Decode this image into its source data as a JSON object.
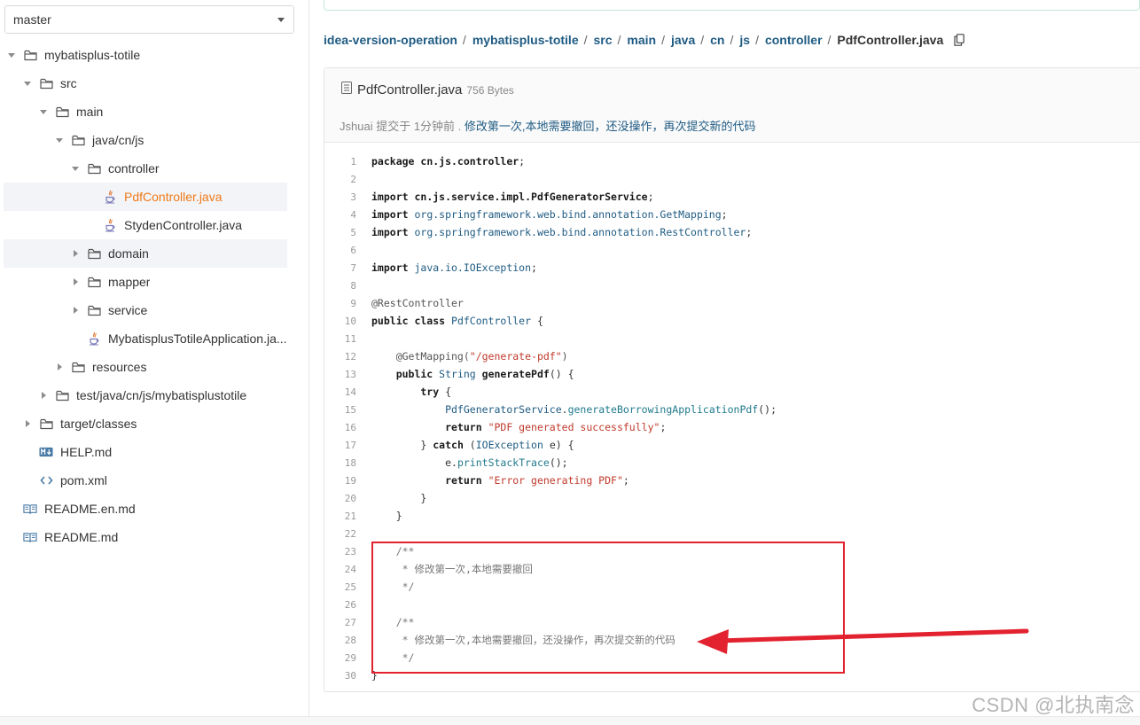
{
  "branch": {
    "selected": "master"
  },
  "tree": [
    {
      "label": "mybatisplus-totile",
      "indent": 0,
      "arrow": "down",
      "icon": "folder-icon"
    },
    {
      "label": "src",
      "indent": 1,
      "arrow": "down",
      "icon": "folder-icon"
    },
    {
      "label": "main",
      "indent": 2,
      "arrow": "down",
      "icon": "folder-icon"
    },
    {
      "label": "java/cn/js",
      "indent": 3,
      "arrow": "down",
      "icon": "folder-icon"
    },
    {
      "label": "controller",
      "indent": 4,
      "arrow": "down",
      "icon": "folder-icon"
    },
    {
      "label": "PdfController.java",
      "indent": 5,
      "arrow": "none",
      "icon": "java-icon",
      "selected": true
    },
    {
      "label": "StydenController.java",
      "indent": 5,
      "arrow": "none",
      "icon": "java-icon"
    },
    {
      "label": "domain",
      "indent": 4,
      "arrow": "right",
      "icon": "folder-icon",
      "hover": true
    },
    {
      "label": "mapper",
      "indent": 4,
      "arrow": "right",
      "icon": "folder-icon"
    },
    {
      "label": "service",
      "indent": 4,
      "arrow": "right",
      "icon": "folder-icon"
    },
    {
      "label": "MybatisplusTotileApplication.ja...",
      "indent": 4,
      "arrow": "none",
      "icon": "java-icon"
    },
    {
      "label": "resources",
      "indent": 3,
      "arrow": "right",
      "icon": "folder-icon"
    },
    {
      "label": "test/java/cn/js/mybatisplustotile",
      "indent": 2,
      "arrow": "right",
      "icon": "folder-icon"
    },
    {
      "label": "target/classes",
      "indent": 1,
      "arrow": "right",
      "icon": "folder-icon"
    },
    {
      "label": "HELP.md",
      "indent": 1,
      "arrow": "none",
      "icon": "markdown-icon"
    },
    {
      "label": "pom.xml",
      "indent": 1,
      "arrow": "none",
      "icon": "code-icon"
    },
    {
      "label": "README.en.md",
      "indent": 0,
      "arrow": "none",
      "icon": "book-icon"
    },
    {
      "label": "README.md",
      "indent": 0,
      "arrow": "none",
      "icon": "book-icon"
    }
  ],
  "breadcrumb": [
    "idea-version-operation",
    "mybatisplus-totile",
    "src",
    "main",
    "java",
    "cn",
    "js",
    "controller",
    "PdfController.java"
  ],
  "file": {
    "name": "PdfController.java",
    "size": "756 Bytes",
    "author": "Jshuai",
    "committed_text": "提交于 1分钟前 .",
    "commit_message": "修改第一次,本地需要撤回，还没操作，再次提交新的代码"
  },
  "code_lines": [
    [
      {
        "t": "package ",
        "c": "kw"
      },
      {
        "t": "cn.js.controller",
        "c": "kw"
      },
      {
        "t": ";",
        "c": ""
      }
    ],
    [],
    [
      {
        "t": "import ",
        "c": "kw"
      },
      {
        "t": "cn.js.service.impl.PdfGeneratorService",
        "c": "kw"
      },
      {
        "t": ";",
        "c": ""
      }
    ],
    [
      {
        "t": "import ",
        "c": "kw"
      },
      {
        "t": "org.springframework.web.bind.annotation.GetMapping",
        "c": "pk"
      },
      {
        "t": ";",
        "c": ""
      }
    ],
    [
      {
        "t": "import ",
        "c": "kw"
      },
      {
        "t": "org.springframework.web.bind.annotation.RestController",
        "c": "pk"
      },
      {
        "t": ";",
        "c": ""
      }
    ],
    [],
    [
      {
        "t": "import ",
        "c": "kw"
      },
      {
        "t": "java.io.IOException",
        "c": "pk"
      },
      {
        "t": ";",
        "c": ""
      }
    ],
    [],
    [
      {
        "t": "@RestController",
        "c": "an"
      }
    ],
    [
      {
        "t": "public class ",
        "c": "kw"
      },
      {
        "t": "PdfController",
        "c": "ty"
      },
      {
        "t": " {",
        "c": ""
      }
    ],
    [],
    [
      {
        "t": "    @GetMapping(",
        "c": "an"
      },
      {
        "t": "\"/generate-pdf\"",
        "c": "st"
      },
      {
        "t": ")",
        "c": "an"
      }
    ],
    [
      {
        "t": "    public ",
        "c": "kw"
      },
      {
        "t": "String ",
        "c": "ty"
      },
      {
        "t": "generatePdf",
        "c": "fn"
      },
      {
        "t": "() {",
        "c": ""
      }
    ],
    [
      {
        "t": "        try ",
        "c": "kw"
      },
      {
        "t": "{",
        "c": ""
      }
    ],
    [
      {
        "t": "            PdfGeneratorService",
        "c": "ty"
      },
      {
        "t": ".",
        "c": ""
      },
      {
        "t": "generateBorrowingApplicationPdf",
        "c": "mt"
      },
      {
        "t": "();",
        "c": ""
      }
    ],
    [
      {
        "t": "            return ",
        "c": "kw"
      },
      {
        "t": "\"PDF generated successfully\"",
        "c": "st"
      },
      {
        "t": ";",
        "c": ""
      }
    ],
    [
      {
        "t": "        } ",
        "c": ""
      },
      {
        "t": "catch ",
        "c": "kw"
      },
      {
        "t": "(",
        "c": ""
      },
      {
        "t": "IOException",
        "c": "ty"
      },
      {
        "t": " e) {",
        "c": ""
      }
    ],
    [
      {
        "t": "            e",
        "c": ""
      },
      {
        "t": ".",
        "c": ""
      },
      {
        "t": "printStackTrace",
        "c": "mt"
      },
      {
        "t": "();",
        "c": ""
      }
    ],
    [
      {
        "t": "            return ",
        "c": "kw"
      },
      {
        "t": "\"Error generating PDF\"",
        "c": "st"
      },
      {
        "t": ";",
        "c": ""
      }
    ],
    [
      {
        "t": "        }",
        "c": ""
      }
    ],
    [
      {
        "t": "    }",
        "c": ""
      }
    ],
    [],
    [
      {
        "t": "    /**",
        "c": "cm"
      }
    ],
    [
      {
        "t": "     * 修改第一次,本地需要撤回",
        "c": "cm"
      }
    ],
    [
      {
        "t": "     */",
        "c": "cm"
      }
    ],
    [],
    [
      {
        "t": "    /**",
        "c": "cm"
      }
    ],
    [
      {
        "t": "     * 修改第一次,本地需要撤回，还没操作，再次提交新的代码",
        "c": "cm"
      }
    ],
    [
      {
        "t": "     */",
        "c": "cm"
      }
    ],
    [
      {
        "t": "}",
        "c": ""
      }
    ]
  ],
  "watermark": "CSDN @北执南念",
  "colors": {
    "link": "#1f5b83",
    "selected_file": "#f07a1a",
    "annotation_red": "#e3222f"
  }
}
